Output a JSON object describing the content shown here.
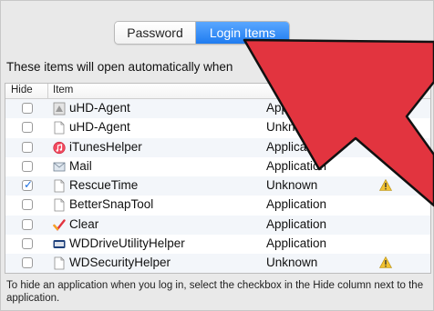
{
  "tabs": [
    {
      "label": "Password",
      "active": false
    },
    {
      "label": "Login Items",
      "active": true
    }
  ],
  "intro_text": "These items will open automatically when",
  "table": {
    "headers": {
      "hide": "Hide",
      "item": "Item"
    },
    "rows": [
      {
        "checked": false,
        "name": "uHD-Agent",
        "kind": "Application",
        "icon": "app-icon",
        "warning": false
      },
      {
        "checked": false,
        "name": "uHD-Agent",
        "kind": "Unknown",
        "icon": "document-icon",
        "warning": true
      },
      {
        "checked": false,
        "name": "iTunesHelper",
        "kind": "Application",
        "icon": "itunes-icon",
        "warning": false
      },
      {
        "checked": false,
        "name": "Mail",
        "kind": "Application",
        "icon": "mail-icon",
        "warning": false
      },
      {
        "checked": true,
        "name": "RescueTime",
        "kind": "Unknown",
        "icon": "document-icon",
        "warning": true
      },
      {
        "checked": false,
        "name": "BetterSnapTool",
        "kind": "Application",
        "icon": "document-icon",
        "warning": false
      },
      {
        "checked": false,
        "name": "Clear",
        "kind": "Application",
        "icon": "clear-icon",
        "warning": false
      },
      {
        "checked": false,
        "name": "WDDriveUtilityHelper",
        "kind": "Application",
        "icon": "drive-icon",
        "warning": false
      },
      {
        "checked": false,
        "name": "WDSecurityHelper",
        "kind": "Unknown",
        "icon": "document-icon",
        "warning": true
      }
    ]
  },
  "footer_text": "To hide an application when you log in, select the checkbox in the Hide column next to the application.",
  "colors": {
    "accent": "#1f7cf0",
    "arrow": "#e2343f",
    "warning": "#f2c230"
  }
}
